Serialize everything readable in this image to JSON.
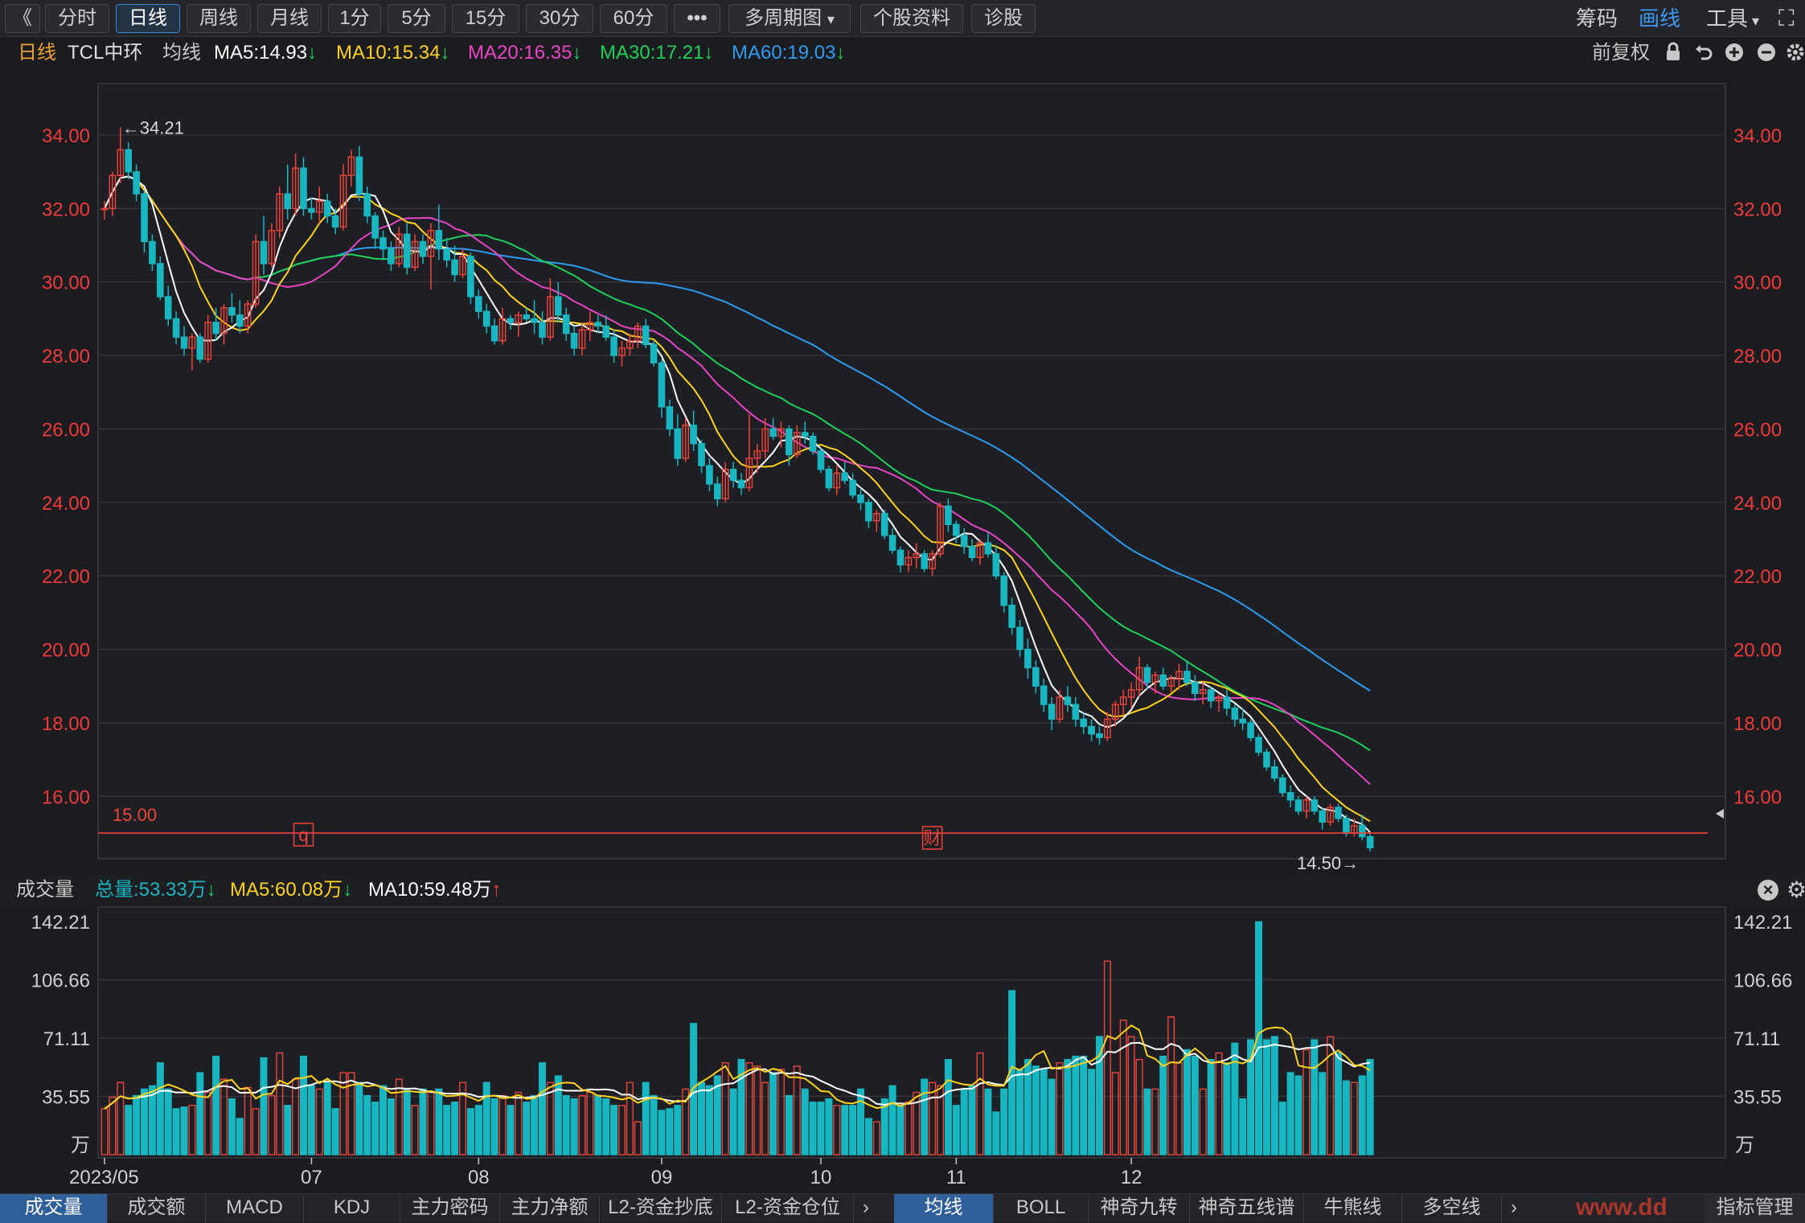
{
  "toolbar": {
    "back": "《",
    "periods": [
      "分时",
      "日线",
      "周线",
      "月线",
      "1分",
      "5分",
      "15分",
      "30分",
      "60分"
    ],
    "active_period": "日线",
    "more": "•••",
    "multi_period": "多周期图",
    "stock_info": "个股资料",
    "diagnose": "诊股",
    "chips": "筹码",
    "draw": "画线",
    "tools": "工具"
  },
  "legend": {
    "period": "日线",
    "stock": "TCL中环",
    "avg_label": "均线",
    "ma5": "MA5:14.93",
    "ma10": "MA10:15.34",
    "ma20": "MA20:16.35",
    "ma30": "MA30:17.21",
    "ma60": "MA60:19.03",
    "adjust": "前复权"
  },
  "volume_header": {
    "title": "成交量",
    "total": "总量:53.33万",
    "ma5": "MA5:60.08万",
    "ma10": "MA10:59.48万"
  },
  "bottom_tabs_left": [
    "成交量",
    "成交额",
    "MACD",
    "KDJ",
    "主力密码",
    "主力净额",
    "L2-资金抄底",
    "L2-资金仓位"
  ],
  "bottom_tabs_right": [
    "均线",
    "BOLL",
    "神奇九转",
    "神奇五线谱",
    "牛熊线",
    "多空线"
  ],
  "bottom_active_left": "成交量",
  "bottom_active_right": "均线",
  "indicator_manage": "指标管理",
  "watermark": "www.dd",
  "colors": {
    "up": "#f0443a",
    "down": "#18b6c0",
    "ma5": "#ffffff",
    "ma10": "#ffd21c",
    "ma20": "#ea44c4",
    "ma30": "#1ed05a",
    "ma60": "#2d9cf0",
    "price_axis": "#ee3a3a",
    "grid": "#3a3b41"
  },
  "icons": [
    "lock-icon",
    "undo-icon",
    "zoom-in-icon",
    "zoom-out-icon",
    "gear-icon",
    "close-icon",
    "fullscreen-icon"
  ],
  "chart_data": [
    {
      "type": "candlestick",
      "ylim": [
        14.3,
        35.4
      ],
      "y_ticks": [
        "34.00",
        "32.00",
        "30.00",
        "28.00",
        "26.00",
        "24.00",
        "22.00",
        "20.00",
        "18.00",
        "16.00"
      ],
      "x_labels": [
        "2023/05",
        "07",
        "08",
        "09",
        "10",
        "11",
        "12"
      ],
      "high_marker": "←34.21",
      "low_marker": "14.50→",
      "reference_line": 15.0,
      "reference_label": "15.00",
      "event_markers": [
        "q",
        "财"
      ],
      "ma5": 14.93,
      "ma10": 15.34,
      "ma20": 16.35,
      "ma30": 17.21,
      "ma60": 19.03,
      "ohlc": [
        [
          32.0,
          32.2,
          31.7,
          32.0
        ],
        [
          32.0,
          33.0,
          31.8,
          32.9
        ],
        [
          32.9,
          34.21,
          32.7,
          33.6
        ],
        [
          33.6,
          33.8,
          32.8,
          33.0
        ],
        [
          33.0,
          33.2,
          32.2,
          32.4
        ],
        [
          32.4,
          32.5,
          30.8,
          31.1
        ],
        [
          31.1,
          31.3,
          30.3,
          30.5
        ],
        [
          30.5,
          30.7,
          29.5,
          29.6
        ],
        [
          29.6,
          29.9,
          28.8,
          29.0
        ],
        [
          29.0,
          29.2,
          28.3,
          28.5
        ],
        [
          28.5,
          28.8,
          28.0,
          28.2
        ],
        [
          28.2,
          28.6,
          27.6,
          28.5
        ],
        [
          28.5,
          28.6,
          27.8,
          27.9
        ],
        [
          27.9,
          29.1,
          27.8,
          28.9
        ],
        [
          28.9,
          29.3,
          28.4,
          28.6
        ],
        [
          28.6,
          29.4,
          28.3,
          29.3
        ],
        [
          29.3,
          29.7,
          28.9,
          29.1
        ],
        [
          29.1,
          29.5,
          28.6,
          28.8
        ],
        [
          28.8,
          29.5,
          28.6,
          29.4
        ],
        [
          29.4,
          31.3,
          29.3,
          31.1
        ],
        [
          31.1,
          31.8,
          30.2,
          30.5
        ],
        [
          30.5,
          31.6,
          30.4,
          31.4
        ],
        [
          31.4,
          32.6,
          31.2,
          32.4
        ],
        [
          32.4,
          33.2,
          31.7,
          32.0
        ],
        [
          32.0,
          33.5,
          31.8,
          33.1
        ],
        [
          33.1,
          33.4,
          31.8,
          32.0
        ],
        [
          32.0,
          32.3,
          31.7,
          31.9
        ],
        [
          31.9,
          32.6,
          31.6,
          32.2
        ],
        [
          32.2,
          32.4,
          31.6,
          31.8
        ],
        [
          31.8,
          32.0,
          31.3,
          31.5
        ],
        [
          31.5,
          33.2,
          31.4,
          32.9
        ],
        [
          32.9,
          33.6,
          32.6,
          33.4
        ],
        [
          33.4,
          33.7,
          32.2,
          32.4
        ],
        [
          32.4,
          32.6,
          31.6,
          31.8
        ],
        [
          31.8,
          31.9,
          30.9,
          31.2
        ],
        [
          31.2,
          31.4,
          30.6,
          30.9
        ],
        [
          30.9,
          31.1,
          30.3,
          30.5
        ],
        [
          30.5,
          31.5,
          30.4,
          31.3
        ],
        [
          31.3,
          31.6,
          30.2,
          30.4
        ],
        [
          30.4,
          31.3,
          30.3,
          31.1
        ],
        [
          31.1,
          31.3,
          30.5,
          30.7
        ],
        [
          30.7,
          31.6,
          29.8,
          31.4
        ],
        [
          31.4,
          32.1,
          30.6,
          30.9
        ],
        [
          30.9,
          31.2,
          30.4,
          30.6
        ],
        [
          30.6,
          31.0,
          30.0,
          30.2
        ],
        [
          30.2,
          30.9,
          30.1,
          30.7
        ],
        [
          30.7,
          30.8,
          29.4,
          29.6
        ],
        [
          29.6,
          29.8,
          29.0,
          29.2
        ],
        [
          29.2,
          29.4,
          28.6,
          28.8
        ],
        [
          28.8,
          29.0,
          28.3,
          28.4
        ],
        [
          28.4,
          29.3,
          28.3,
          29.0
        ],
        [
          29.0,
          29.1,
          28.7,
          28.9
        ],
        [
          28.9,
          29.2,
          28.5,
          29.1
        ],
        [
          29.1,
          29.3,
          28.9,
          29.0
        ],
        [
          29.0,
          29.5,
          28.6,
          28.9
        ],
        [
          28.9,
          29.2,
          28.3,
          28.5
        ],
        [
          28.5,
          30.1,
          28.4,
          29.6
        ],
        [
          29.6,
          30.0,
          28.9,
          29.1
        ],
        [
          29.1,
          29.3,
          28.4,
          28.6
        ],
        [
          28.6,
          28.8,
          28.0,
          28.2
        ],
        [
          28.2,
          28.9,
          28.0,
          28.7
        ],
        [
          28.7,
          29.2,
          28.4,
          28.9
        ],
        [
          28.9,
          29.1,
          28.6,
          28.8
        ],
        [
          28.8,
          29.1,
          28.4,
          28.5
        ],
        [
          28.5,
          28.7,
          27.8,
          28.0
        ],
        [
          28.0,
          28.4,
          27.7,
          28.2
        ],
        [
          28.2,
          28.6,
          28.0,
          28.4
        ],
        [
          28.4,
          28.9,
          28.2,
          28.8
        ],
        [
          28.8,
          29.0,
          28.2,
          28.3
        ],
        [
          28.3,
          28.4,
          27.7,
          27.8
        ],
        [
          27.8,
          27.9,
          26.3,
          26.6
        ],
        [
          26.6,
          26.8,
          25.8,
          26.0
        ],
        [
          26.0,
          26.4,
          25.0,
          25.2
        ],
        [
          25.2,
          26.3,
          25.1,
          26.1
        ],
        [
          26.1,
          26.5,
          25.4,
          25.6
        ],
        [
          25.6,
          25.7,
          24.8,
          25.0
        ],
        [
          25.0,
          25.2,
          24.3,
          24.5
        ],
        [
          24.5,
          24.7,
          23.9,
          24.1
        ],
        [
          24.1,
          25.1,
          24.0,
          24.9
        ],
        [
          24.9,
          25.1,
          24.4,
          24.6
        ],
        [
          24.6,
          24.8,
          24.2,
          24.4
        ],
        [
          24.4,
          26.4,
          24.3,
          25.2
        ],
        [
          25.2,
          25.6,
          24.8,
          25.4
        ],
        [
          25.4,
          26.3,
          25.2,
          26.0
        ],
        [
          26.0,
          26.3,
          25.7,
          25.8
        ],
        [
          25.8,
          26.2,
          25.5,
          26.0
        ],
        [
          26.0,
          26.1,
          25.0,
          25.3
        ],
        [
          25.3,
          26.1,
          25.2,
          25.9
        ],
        [
          25.9,
          26.2,
          25.6,
          25.8
        ],
        [
          25.8,
          25.9,
          25.3,
          25.4
        ],
        [
          25.4,
          25.5,
          24.8,
          24.9
        ],
        [
          24.9,
          25.0,
          24.3,
          24.4
        ],
        [
          24.4,
          25.0,
          24.2,
          24.8
        ],
        [
          24.8,
          25.1,
          24.5,
          24.6
        ],
        [
          24.6,
          24.8,
          24.1,
          24.2
        ],
        [
          24.2,
          24.4,
          23.8,
          24.0
        ],
        [
          24.0,
          24.1,
          23.3,
          23.5
        ],
        [
          23.5,
          23.8,
          23.2,
          23.7
        ],
        [
          23.7,
          23.8,
          23.0,
          23.1
        ],
        [
          23.1,
          23.3,
          22.6,
          22.7
        ],
        [
          22.7,
          22.8,
          22.1,
          22.3
        ],
        [
          22.3,
          22.7,
          22.1,
          22.5
        ],
        [
          22.5,
          22.9,
          22.2,
          22.6
        ],
        [
          22.6,
          22.7,
          22.1,
          22.2
        ],
        [
          22.2,
          22.7,
          22.0,
          22.6
        ],
        [
          22.6,
          24.0,
          22.5,
          23.9
        ],
        [
          23.9,
          24.1,
          23.2,
          23.4
        ],
        [
          23.4,
          23.5,
          22.9,
          23.1
        ],
        [
          23.1,
          23.3,
          22.6,
          22.8
        ],
        [
          22.8,
          23.0,
          22.4,
          22.5
        ],
        [
          22.5,
          23.0,
          22.3,
          22.9
        ],
        [
          22.9,
          23.2,
          22.5,
          22.6
        ],
        [
          22.6,
          22.8,
          21.9,
          22.0
        ],
        [
          22.0,
          22.1,
          21.0,
          21.2
        ],
        [
          21.2,
          21.4,
          20.4,
          20.6
        ],
        [
          20.6,
          20.8,
          19.8,
          20.0
        ],
        [
          20.0,
          20.3,
          19.2,
          19.5
        ],
        [
          19.5,
          19.7,
          18.8,
          19.0
        ],
        [
          19.0,
          19.2,
          18.3,
          18.5
        ],
        [
          18.5,
          18.7,
          17.8,
          18.1
        ],
        [
          18.1,
          18.9,
          18.0,
          18.7
        ],
        [
          18.7,
          19.0,
          18.3,
          18.5
        ],
        [
          18.5,
          18.7,
          17.9,
          18.1
        ],
        [
          18.1,
          18.3,
          17.7,
          17.9
        ],
        [
          17.9,
          18.1,
          17.5,
          17.7
        ],
        [
          17.7,
          17.9,
          17.4,
          17.6
        ],
        [
          17.6,
          18.3,
          17.5,
          18.1
        ],
        [
          18.1,
          18.6,
          17.9,
          18.5
        ],
        [
          18.5,
          18.9,
          18.2,
          18.7
        ],
        [
          18.7,
          19.1,
          18.4,
          18.9
        ],
        [
          18.9,
          19.8,
          18.7,
          19.5
        ],
        [
          19.5,
          19.6,
          18.9,
          19.1
        ],
        [
          19.1,
          19.4,
          18.8,
          19.3
        ],
        [
          19.3,
          19.5,
          18.9,
          19.0
        ],
        [
          19.0,
          19.3,
          18.8,
          19.2
        ],
        [
          19.2,
          19.6,
          18.9,
          19.4
        ],
        [
          19.4,
          19.7,
          19.0,
          19.1
        ],
        [
          19.1,
          19.3,
          18.6,
          18.8
        ],
        [
          18.8,
          19.1,
          18.5,
          18.9
        ],
        [
          18.9,
          19.0,
          18.4,
          18.6
        ],
        [
          18.6,
          18.8,
          18.3,
          18.7
        ],
        [
          18.7,
          18.9,
          18.2,
          18.4
        ],
        [
          18.4,
          18.5,
          17.9,
          18.1
        ],
        [
          18.1,
          18.4,
          17.8,
          18.0
        ],
        [
          18.0,
          18.1,
          17.5,
          17.6
        ],
        [
          17.6,
          17.7,
          17.1,
          17.2
        ],
        [
          17.2,
          17.3,
          16.7,
          16.8
        ],
        [
          16.8,
          17.0,
          16.4,
          16.5
        ],
        [
          16.5,
          16.6,
          16.0,
          16.1
        ],
        [
          16.1,
          16.3,
          15.7,
          15.9
        ],
        [
          15.9,
          16.0,
          15.5,
          15.6
        ],
        [
          15.6,
          16.0,
          15.4,
          15.9
        ],
        [
          15.9,
          16.0,
          15.5,
          15.6
        ],
        [
          15.6,
          15.7,
          15.1,
          15.3
        ],
        [
          15.3,
          15.8,
          15.2,
          15.7
        ],
        [
          15.7,
          15.8,
          15.3,
          15.4
        ],
        [
          15.4,
          15.5,
          14.9,
          15.0
        ],
        [
          15.0,
          15.4,
          14.9,
          15.2
        ],
        [
          15.2,
          15.5,
          14.8,
          14.9
        ],
        [
          14.9,
          15.0,
          14.5,
          14.6
        ]
      ]
    },
    {
      "type": "bar",
      "ylim": [
        0,
        142.21
      ],
      "unit": "万",
      "y_ticks": [
        "142.21",
        "106.66",
        "71.11",
        "35.55"
      ],
      "volume": [
        28,
        35,
        44,
        30,
        36,
        40,
        42,
        56,
        40,
        28,
        29,
        30,
        50,
        38,
        60,
        46,
        34,
        22,
        41,
        28,
        59,
        36,
        62,
        30,
        46,
        60,
        42,
        40,
        44,
        28,
        50,
        50,
        44,
        36,
        32,
        42,
        34,
        46,
        40,
        30,
        40,
        38,
        40,
        30,
        32,
        44,
        28,
        30,
        44,
        34,
        36,
        30,
        38,
        32,
        36,
        56,
        44,
        48,
        36,
        34,
        36,
        38,
        36,
        34,
        30,
        30,
        44,
        20,
        44,
        36,
        27,
        28,
        30,
        40,
        80,
        44,
        42,
        48,
        56,
        40,
        58,
        56,
        54,
        44,
        50,
        52,
        36,
        54,
        40,
        32,
        32,
        34,
        30,
        30,
        30,
        40,
        22,
        20,
        34,
        42,
        30,
        32,
        38,
        46,
        44,
        42,
        58,
        30,
        40,
        42,
        62,
        40,
        26,
        40,
        100,
        52,
        58,
        54,
        52,
        46,
        56,
        58,
        60,
        60,
        52,
        72,
        118,
        50,
        82,
        72,
        58,
        40,
        40,
        60,
        84,
        56,
        64,
        60,
        40,
        58,
        62,
        56,
        68,
        34,
        70,
        142,
        70,
        72,
        32,
        50,
        48,
        64,
        70,
        50,
        72,
        62,
        45,
        44,
        48,
        58
      ]
    }
  ]
}
